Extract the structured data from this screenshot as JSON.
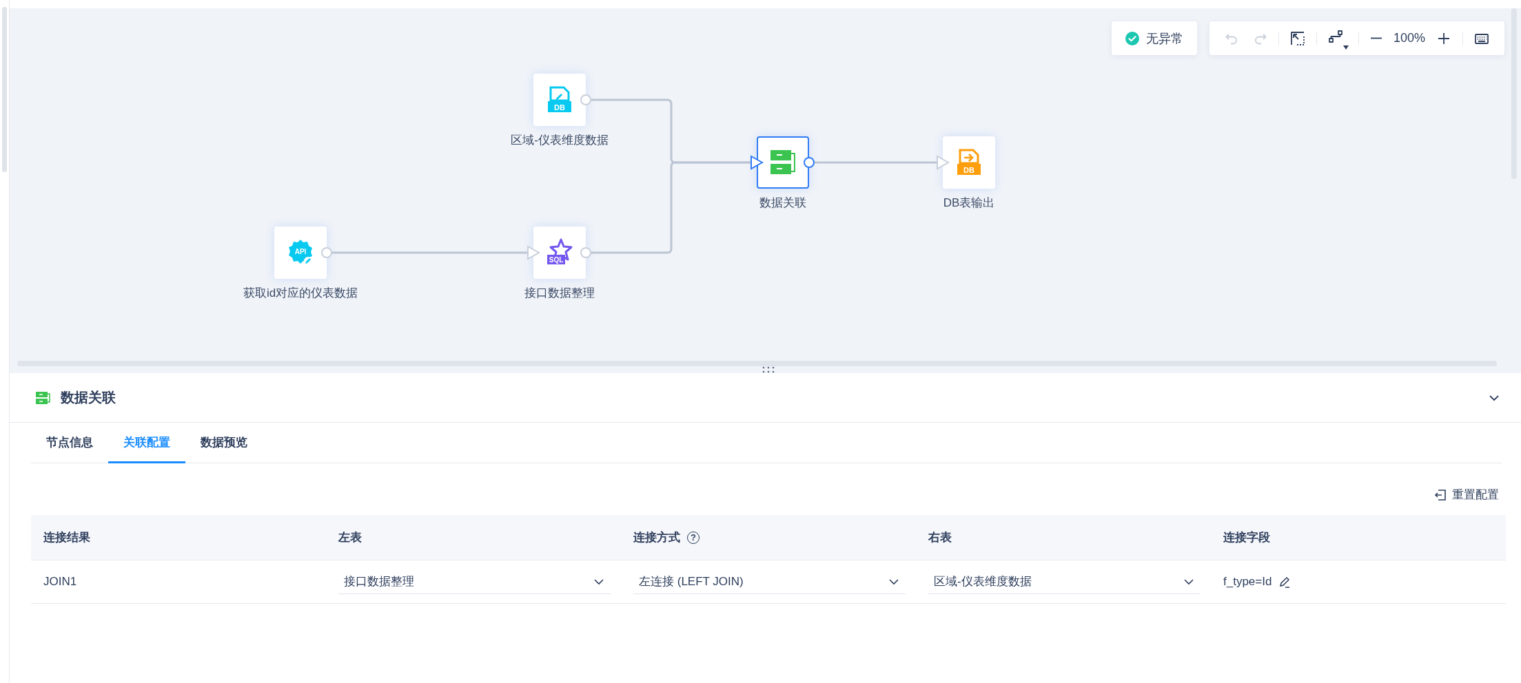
{
  "canvas": {
    "status": {
      "label": "无异常"
    },
    "toolbar": {
      "buttons": [
        {
          "kind": "undo",
          "disabled": true
        },
        {
          "kind": "redo",
          "disabled": true
        },
        {
          "kind": "fit",
          "disabled": false
        },
        {
          "kind": "route",
          "disabled": false
        },
        {
          "kind": "zoom-out",
          "disabled": false
        },
        {
          "kind": "zoom-in",
          "disabled": false
        },
        {
          "kind": "keyboard",
          "disabled": false
        }
      ],
      "zoom": "100%"
    },
    "nodes": [
      {
        "label": "区域-仪表维度数据",
        "kind": "db-input",
        "icon_text": "DB",
        "selected": false
      },
      {
        "label": "获取id对应的仪表数据",
        "kind": "api",
        "icon_text": "API",
        "selected": false
      },
      {
        "label": "接口数据整理",
        "kind": "sql",
        "icon_text": "SQL",
        "selected": false
      },
      {
        "label": "数据关联",
        "kind": "join",
        "selected": true
      },
      {
        "label": "DB表输出",
        "kind": "db-output",
        "icon_text": "DB",
        "selected": false
      }
    ]
  },
  "panel": {
    "title": "数据关联",
    "tabs": [
      {
        "label": "节点信息",
        "selected": false
      },
      {
        "label": "关联配置",
        "selected": true
      },
      {
        "label": "数据预览",
        "selected": false
      }
    ],
    "reset_button": "重置配置",
    "table": {
      "columns": [
        {
          "label": "连接结果"
        },
        {
          "label": "左表"
        },
        {
          "label": "连接方式",
          "help_icon": "?"
        },
        {
          "label": "右表"
        },
        {
          "label": "连接字段"
        }
      ],
      "rows": [
        {
          "cells": [
            {
              "kind": "text",
              "value": "JOIN1"
            },
            {
              "kind": "select",
              "value": "接口数据整理"
            },
            {
              "kind": "select",
              "value": "左连接 (LEFT JOIN)"
            },
            {
              "kind": "select",
              "value": "区域-仪表维度数据"
            },
            {
              "kind": "editable",
              "value": "f_type=Id"
            }
          ]
        }
      ]
    }
  }
}
